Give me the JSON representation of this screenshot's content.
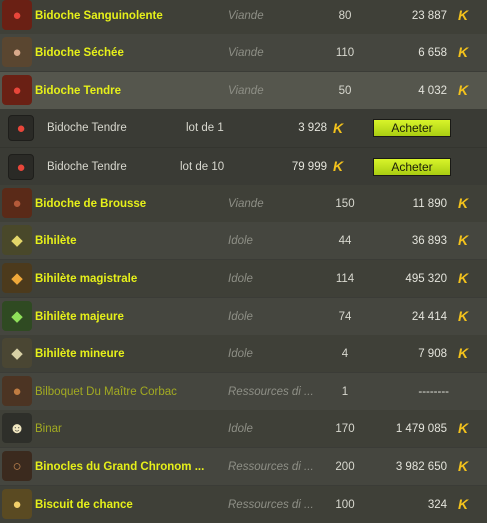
{
  "currency_icon": "kamas-icon",
  "colors": {
    "name": "#e6f01a",
    "name_dim": "#a2aa22",
    "category": "#8e8f86",
    "kama": "#f3c21c",
    "buy_button": "#c6e31a"
  },
  "rows": [
    {
      "name": "Bidoche Sanguinolente",
      "category": "Viande",
      "quantity": "80",
      "price": "23 887",
      "icon": "raw-meat-icon"
    },
    {
      "name": "Bidoche Séchée",
      "category": "Viande",
      "quantity": "110",
      "price": "6 658",
      "icon": "dried-meat-icon"
    },
    {
      "name": "Bidoche Tendre",
      "category": "Viande",
      "quantity": "50",
      "price": "4 032",
      "icon": "raw-meat-icon"
    },
    {
      "name": "Bidoche de Brousse",
      "category": "Viande",
      "quantity": "150",
      "price": "11 890",
      "icon": "steak-icon"
    },
    {
      "name": "Bihilète",
      "category": "Idole",
      "quantity": "44",
      "price": "36 893",
      "icon": "idol-icon"
    },
    {
      "name": "Bihilète magistrale",
      "category": "Idole",
      "quantity": "114",
      "price": "495 320",
      "icon": "idol-icon"
    },
    {
      "name": "Bihilète majeure",
      "category": "Idole",
      "quantity": "74",
      "price": "24 414",
      "icon": "idol-icon"
    },
    {
      "name": "Bihilète mineure",
      "category": "Idole",
      "quantity": "4",
      "price": "7 908",
      "icon": "idol-icon"
    },
    {
      "name": "Bilboquet Du Maître Corbac",
      "category": "Ressources di ...",
      "quantity": "1",
      "price": "--------",
      "icon": "cup-and-ball-icon"
    },
    {
      "name": "Binar",
      "category": "Idole",
      "quantity": "170",
      "price": "1 479 085",
      "icon": "idol-icon"
    },
    {
      "name": "Binocles du Grand Chronom ...",
      "category": "Ressources di ...",
      "quantity": "200",
      "price": "3 982 650",
      "icon": "binoculars-icon"
    },
    {
      "name": "Biscuit de chance",
      "category": "Ressources di ...",
      "quantity": "100",
      "price": "324",
      "icon": "fortune-cookie-icon"
    }
  ],
  "lots": [
    {
      "name": "Bidoche Tendre",
      "lot": "lot de 1",
      "price": "3 928",
      "button": "Acheter",
      "icon": "raw-meat-icon"
    },
    {
      "name": "Bidoche Tendre",
      "lot": "lot de 10",
      "price": "79 999",
      "button": "Acheter",
      "icon": "raw-meat-icon"
    }
  ]
}
